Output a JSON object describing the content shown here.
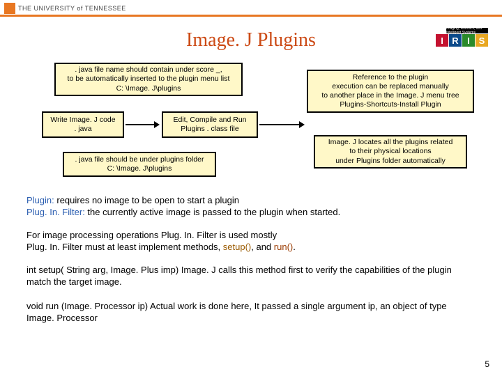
{
  "header": {
    "university": "THE UNIVERSITY of TENNESSEE"
  },
  "title": "Image. J Plugins",
  "iris": {
    "caption": "Imaging, Robotics, and Intelligent Systems",
    "letters": [
      "I",
      "R",
      "I",
      "S"
    ]
  },
  "boxes": {
    "top_left": {
      "l1": ". java file name should contain under score _,",
      "l2": "to be automatically inserted to the plugin menu list",
      "l3": "C: \\Image. J\\plugins"
    },
    "write_code": {
      "l1": "Write Image. J code",
      "l2": ". java"
    },
    "compile": {
      "l1": "Edit, Compile and Run",
      "l2": "Plugins . class file"
    },
    "under_plugins": {
      "l1": ". java file should be under plugins folder",
      "l2": "C: \\Image. J\\plugins"
    },
    "reference": {
      "l1": "Reference to the plugin",
      "l2": "execution can be replaced manually",
      "l3": "to another place in the Image. J menu tree",
      "l4": "Plugins-Shortcuts-Install Plugin"
    },
    "locates": {
      "l1": "Image. J locates all the plugins related",
      "l2": "to their physical locations",
      "l3": "under Plugins folder automatically"
    }
  },
  "paragraphs": {
    "p1a": "Plugin:",
    "p1b": " requires no image to be open to start a plugin",
    "p2a": "Plug. In. Filter:",
    "p2b": " the currently active image is passed to the plugin when started.",
    "p3a": "For image processing operations Plug. In. Filter is used mostly",
    "p3b": "Plug. In. Filter must at least implement methods, ",
    "p3_setup": "setup()",
    "p3_and": ", and ",
    "p3_run": "run()",
    "p3_end": ".",
    "p4": "int setup( String arg, Image. Plus imp) Image. J calls this method first to verify the capabilities of the plugin match the target image.",
    "p5": "void run (Image. Processor ip) Actual work is done here, It passed a single argument ip, an object of type Image. Processor"
  },
  "page_number": "5"
}
